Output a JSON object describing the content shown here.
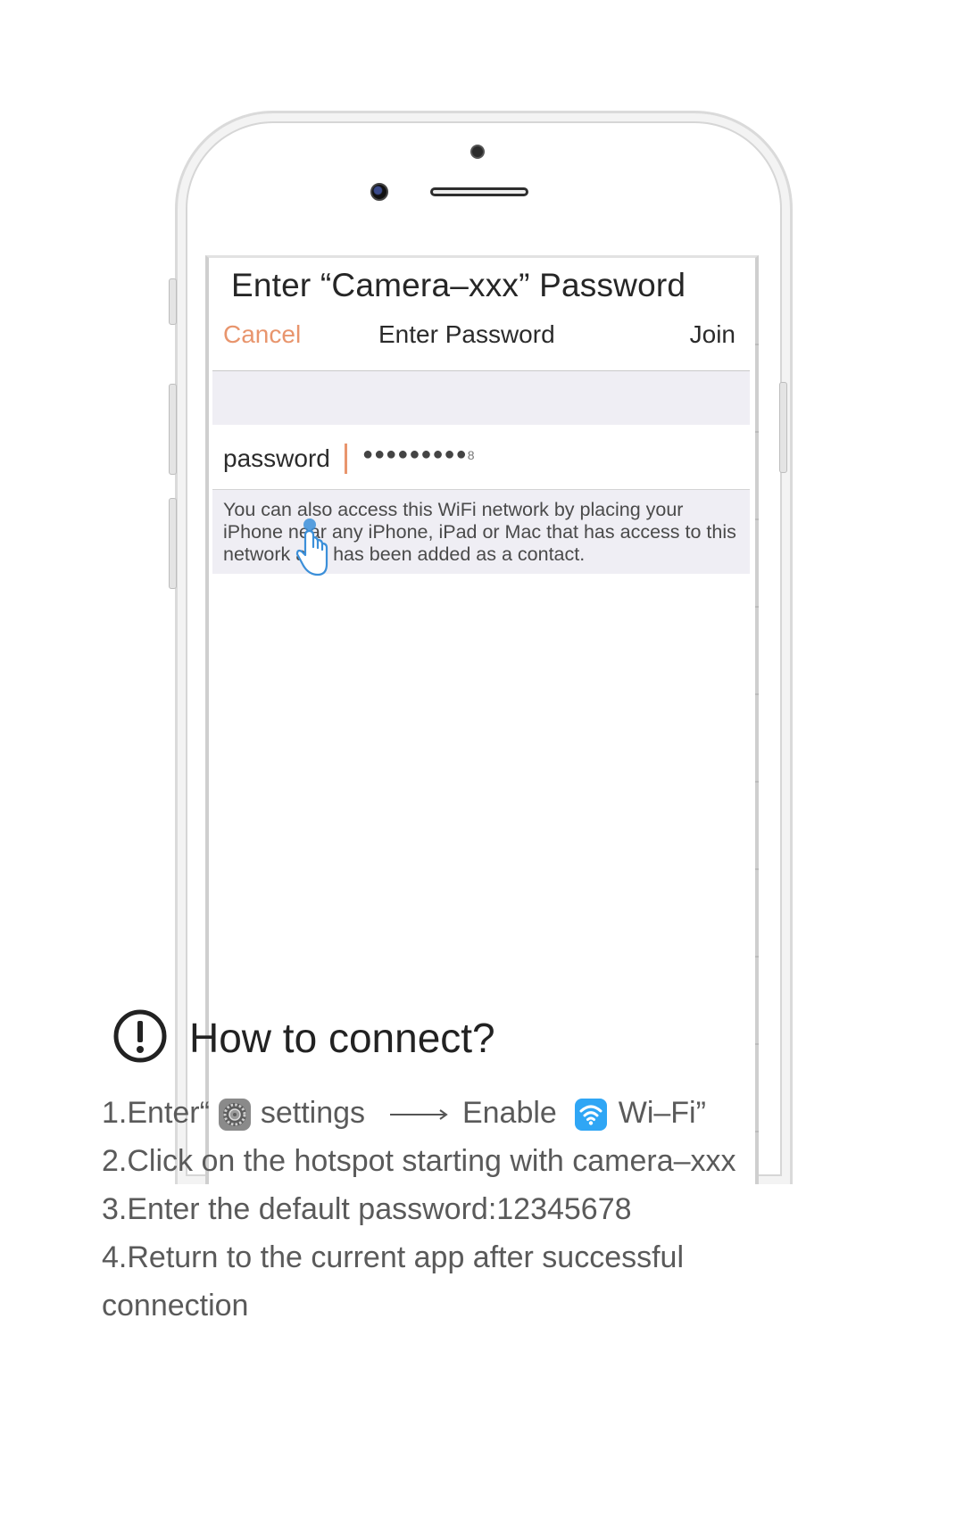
{
  "dialog": {
    "title": "Enter “Camera–xxx” Password",
    "cancel_label": "Cancel",
    "nav_title": "Enter Password",
    "join_label": "Join",
    "password_label": "password",
    "password_mask": "●●●●●●●●●",
    "password_last_char": "8",
    "info_text": "You can also access this WiFi network by placing your iPhone near any iPhone, iPad or Mac that has access to this network and has been added as a contact."
  },
  "instructions": {
    "heading": "How to connect?",
    "step1_prefix": "1.Enter“",
    "step1_settings": "settings",
    "step1_enable": "Enable",
    "step1_suffix": "Wi–Fi”",
    "step2": "2.Click on the hotspot starting with camera–xxx",
    "step3": "3.Enter the default password:12345678",
    "step4": "4.Return to the current app after successful connection"
  },
  "colors": {
    "accent": "#e8956d",
    "wifi_icon_bg": "#2fa6f5",
    "tap_hand": "#3b8fd9"
  },
  "icons": [
    "warning-circle-icon",
    "settings-gear-icon",
    "arrow-right-icon",
    "wifi-icon",
    "tap-hand-icon"
  ]
}
